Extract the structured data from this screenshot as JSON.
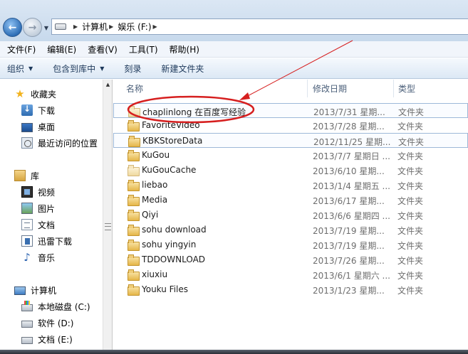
{
  "address": {
    "back_icon": "back-arrow-icon",
    "forward_icon": "forward-arrow-icon",
    "crumbs": [
      "计算机",
      "娱乐 (F:)"
    ]
  },
  "menubar": {
    "items": [
      "文件(F)",
      "编辑(E)",
      "查看(V)",
      "工具(T)",
      "帮助(H)"
    ]
  },
  "commandbar": {
    "organize": "组织",
    "include_in_library": "包含到库中",
    "burn": "刻录",
    "new_folder": "新建文件夹"
  },
  "navpane": {
    "favorites": {
      "label": "收藏夹",
      "items": [
        "下载",
        "桌面",
        "最近访问的位置"
      ]
    },
    "libraries": {
      "label": "库",
      "items": [
        "视频",
        "图片",
        "文档",
        "迅雷下载",
        "音乐"
      ]
    },
    "computer": {
      "label": "计算机",
      "items": [
        "本地磁盘 (C:)",
        "软件 (D:)",
        "文档 (E:)"
      ]
    }
  },
  "filelist": {
    "headers": {
      "name": "名称",
      "date": "修改日期",
      "type": "类型"
    },
    "rows": [
      {
        "name": "chaplinlong 在百度写经验",
        "date": "2013/7/31 星期...",
        "type": "文件夹"
      },
      {
        "name": "FavoriteVideo",
        "date": "2013/7/28 星期...",
        "type": "文件夹"
      },
      {
        "name": "KBKStoreData",
        "date": "2012/11/25 星期...",
        "type": "文件夹"
      },
      {
        "name": "KuGou",
        "date": "2013/7/7 星期日 ...",
        "type": "文件夹"
      },
      {
        "name": "KuGouCache",
        "date": "2013/6/10 星期...",
        "type": "文件夹"
      },
      {
        "name": "liebao",
        "date": "2013/1/4 星期五 ...",
        "type": "文件夹"
      },
      {
        "name": "Media",
        "date": "2013/6/17 星期...",
        "type": "文件夹"
      },
      {
        "name": "Qiyi",
        "date": "2013/6/6 星期四 ...",
        "type": "文件夹"
      },
      {
        "name": "sohu download",
        "date": "2013/7/19 星期...",
        "type": "文件夹"
      },
      {
        "name": "sohu yingyin",
        "date": "2013/7/19 星期...",
        "type": "文件夹"
      },
      {
        "name": "TDDOWNLOAD",
        "date": "2013/7/26 星期...",
        "type": "文件夹"
      },
      {
        "name": "xiuxiu",
        "date": "2013/6/1 星期六 ...",
        "type": "文件夹"
      },
      {
        "name": "Youku Files",
        "date": "2013/1/23 星期...",
        "type": "文件夹"
      }
    ]
  },
  "annotation_color": "#d61f1f"
}
